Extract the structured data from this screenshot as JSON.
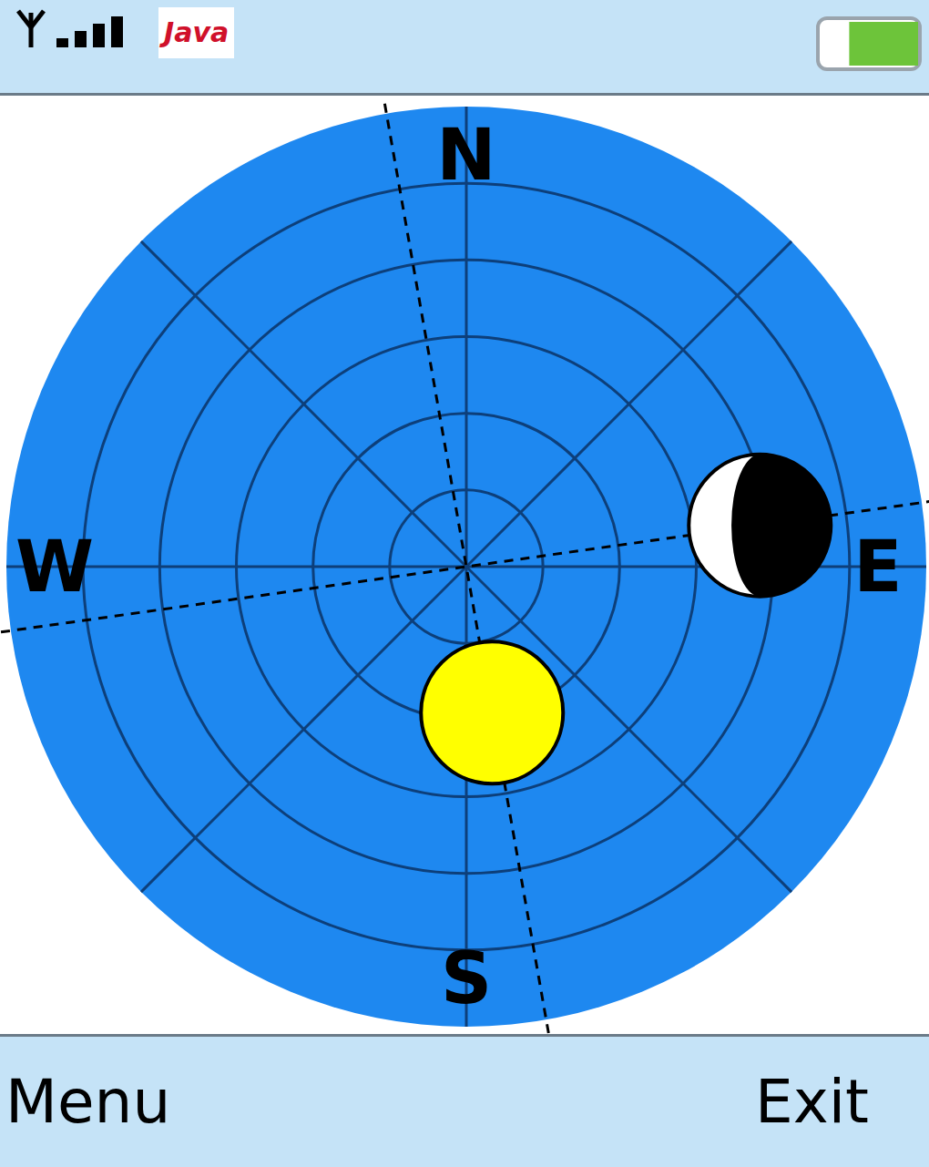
{
  "status_bar": {
    "signal": {
      "level": 1
    },
    "logo": "Java",
    "battery": {
      "level": 0.7
    }
  },
  "sky_chart": {
    "labels": [
      {
        "text": "N",
        "azimuth": 0
      },
      {
        "text": "E",
        "azimuth": 90
      },
      {
        "text": "S",
        "azimuth": 180
      },
      {
        "text": "W",
        "azimuth": 270
      }
    ],
    "altitude_rings": [
      15,
      30,
      45,
      60,
      75
    ],
    "bodies": [
      {
        "kind": "sun",
        "azimuth": 170,
        "altitude": 61
      },
      {
        "kind": "moon",
        "azimuth": 82,
        "altitude": 32,
        "illumination": 0.3,
        "lit_side": "left"
      }
    ]
  },
  "softkeys": [
    {
      "label": "Menu"
    },
    {
      "label": "Exit"
    }
  ]
}
